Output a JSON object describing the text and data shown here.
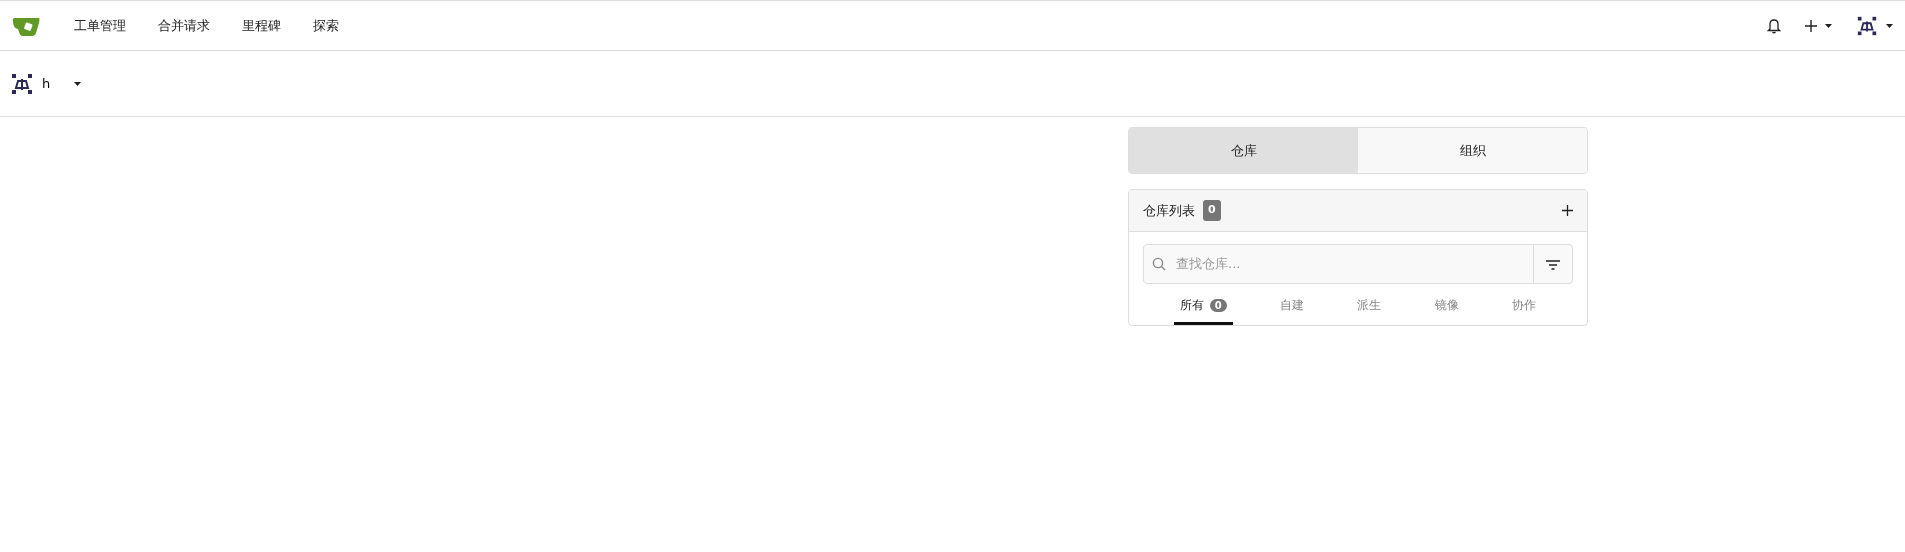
{
  "navbar": {
    "items": [
      {
        "label": "工单管理"
      },
      {
        "label": "合并请求"
      },
      {
        "label": "里程碑"
      },
      {
        "label": "探索"
      }
    ]
  },
  "context": {
    "username": "h"
  },
  "switch_tabs": [
    {
      "label": "仓库",
      "selected": true
    },
    {
      "label": "组织",
      "selected": false
    }
  ],
  "repo_list": {
    "title": "仓库列表",
    "count": "0",
    "search": {
      "placeholder": "查找仓库..."
    },
    "filters": [
      {
        "label": "所有",
        "count": "0",
        "selected": true
      },
      {
        "label": "自建",
        "selected": false
      },
      {
        "label": "派生",
        "selected": false
      },
      {
        "label": "镜像",
        "selected": false
      },
      {
        "label": "协作",
        "selected": false
      }
    ]
  }
}
